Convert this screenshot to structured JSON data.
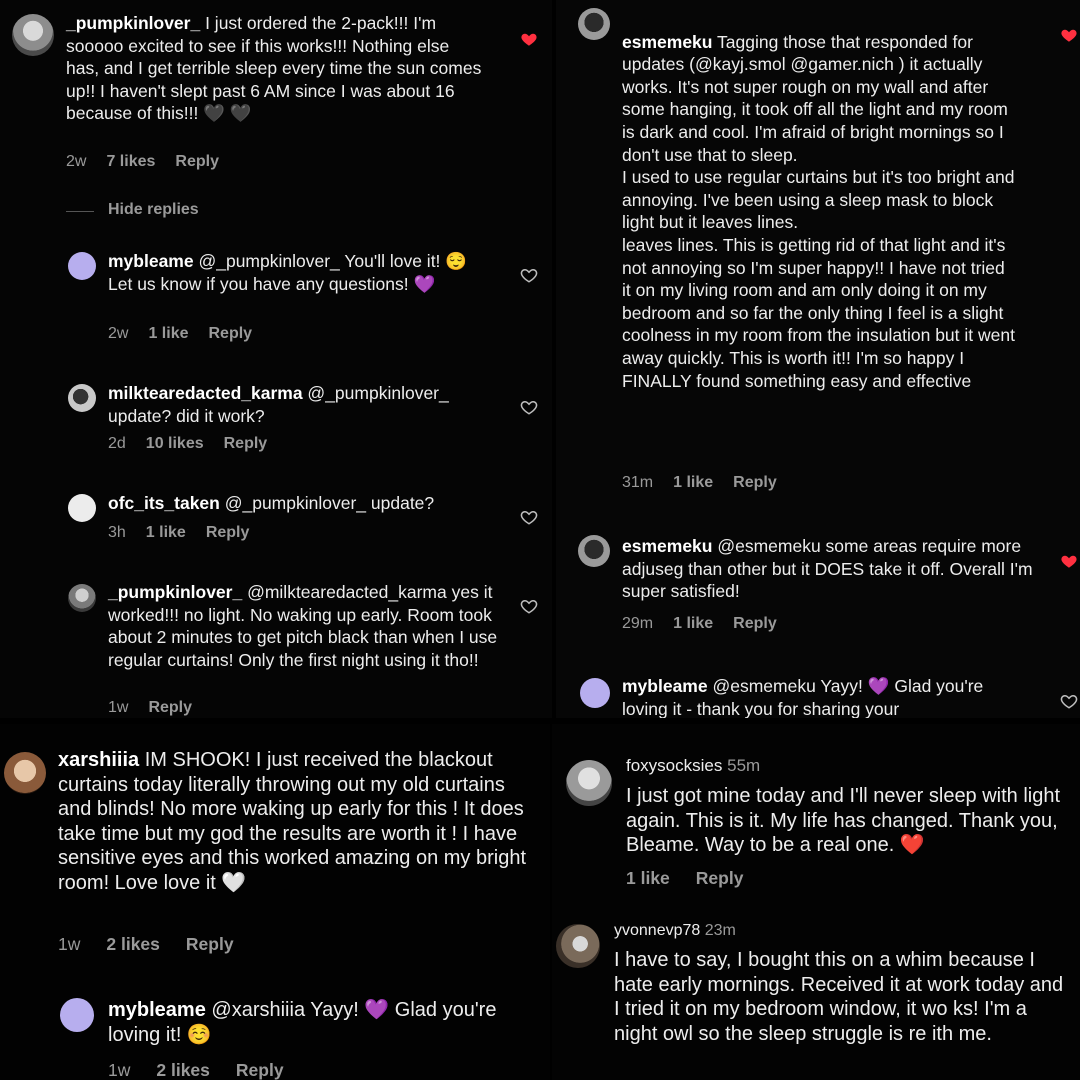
{
  "panel1": {
    "c1": {
      "user": "_pumpkinlover_",
      "text": " I just ordered the 2-pack!!! I'm sooooo excited to see if this works!!! Nothing else has, and I get terrible sleep every time the sun comes up!! I haven't slept past 6 AM since I was about 16 because of this!!! 🖤 🖤",
      "time": "2w",
      "likes": "7 likes",
      "reply": "Reply"
    },
    "hide_replies": "Hide replies",
    "r1": {
      "user": "mybleame",
      "text": " @_pumpkinlover_ You'll love it! 😌 Let us know if you have any questions! 💜",
      "time": "2w",
      "likes": "1 like",
      "reply": "Reply"
    },
    "r2": {
      "user": "milktearedacted_karma",
      "text": " @_pumpkinlover_ update? did it work?",
      "time": "2d",
      "likes": "10 likes",
      "reply": "Reply"
    },
    "r3": {
      "user": "ofc_its_taken",
      "text": " @_pumpkinlover_ update?",
      "time": "3h",
      "likes": "1 like",
      "reply": "Reply"
    },
    "r4": {
      "user": "_pumpkinlover_",
      "text": " @milktearedacted_karma yes it worked!!! no light. No waking up early. Room took about 2 minutes to get pitch black than when I use regular curtains! Only the first night using it tho!!",
      "time": "1w",
      "reply": "Reply"
    }
  },
  "panel2": {
    "c1": {
      "user": "esmemeku",
      "text": " Tagging those that responded for updates (@kayj.smol @gamer.nich ) it actually works. It's not super rough on my wall and after some hanging, it took off all the light and my room is dark and cool. I'm afraid of bright mornings so I don't use that to sleep.\nI used to use regular curtains but it's too bright and annoying. I've been using a sleep mask to block light but it leaves lines.\nleaves lines. This is getting rid of that light and it's not annoying so I'm super happy!! I have not tried it on my living room and am only doing it on my bedroom and so far the only thing I feel is a slight coolness in my room from the insulation but it went away quickly. This is worth it!! I'm so happy I FINALLY found something easy and effective",
      "time": "31m",
      "likes": "1 like",
      "reply": "Reply"
    },
    "c2": {
      "user": "esmemeku",
      "text": " @esmemeku some areas require more adjus‍eg than other but it DOES take it off. Overall I'm super satisfied!",
      "time": "29m",
      "likes": "1 like",
      "reply": "Reply"
    },
    "c3": {
      "user": "mybleame",
      "text": " @esmemeku Yayy! 💜 Glad you're loving it - thank you for sharing your"
    }
  },
  "panel3": {
    "c1": {
      "user": "xarshiiia",
      "text": " IM SHOOK!  I just received the blackout curtains today literally throwing out my old curtains and blinds! No more waking up early for this ! It does take time but my god the results are worth it ! I have sensitive eyes and this worked amazing on my bright room! Love love it 🤍",
      "time": "1w",
      "likes": "2 likes",
      "reply": "Reply"
    },
    "r1": {
      "user": "mybleame",
      "text": " @xarshiiia Yayy! 💜 Glad you're loving it! ☺️",
      "time": "1w",
      "likes": "2 likes",
      "reply": "Reply"
    }
  },
  "panel4": {
    "c1": {
      "user": "foxysocksies",
      "time_inline": "55m",
      "text": "I just got mine today and I'll never sleep with light again. This is it. My life has changed. Thank you, Bleame. Way to be a real one. ❤️",
      "likes": "1 like",
      "reply": "Reply"
    },
    "c2": {
      "user": "yvonnevp78",
      "time_inline": "23m",
      "text": "I have to say, I bought this on a whim because I hate early mornings. Received it at work today and I tried it on my bedroom window, it wo  ks! I'm a night owl so the sleep struggle is re       ith me."
    }
  },
  "colors": {
    "background": "#000000",
    "text": "#ededed",
    "muted": "#9a9a9a",
    "like_red": "#ff3040"
  },
  "icons": [
    "heart-filled-icon",
    "heart-outline-icon"
  ]
}
